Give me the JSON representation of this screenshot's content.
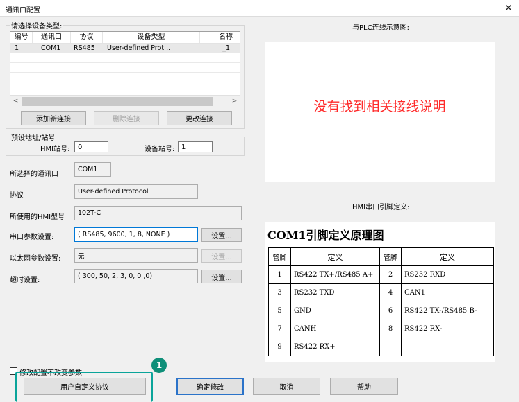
{
  "window": {
    "title": "通讯口配置",
    "close": "✕"
  },
  "device_type": {
    "group_label": "请选择设备类型:",
    "columns": [
      "编号",
      "通讯口",
      "协议",
      "设备类型",
      "名称"
    ],
    "rows": [
      [
        "1",
        "COM1",
        "RS485",
        "User-defined Prot...",
        "_1"
      ]
    ],
    "scroll_left": "<",
    "scroll_right": ">"
  },
  "connection_buttons": {
    "add": "添加新连接",
    "delete": "删除连接",
    "change": "更改连接"
  },
  "station": {
    "group_label": "预设地址/站号",
    "hmi_label": "HMI站号:",
    "hmi_value": "0",
    "device_label": "设备站号:",
    "device_value": "1"
  },
  "fields": {
    "port_label": "所选择的通讯口",
    "port_value": "COM1",
    "protocol_label": "协议",
    "protocol_value": "User-defined Protocol",
    "hmi_model_label": "所使用的HMI型号",
    "hmi_model_value": "102T-C",
    "serial_label": "串口参数设置:",
    "serial_value": "( RS485, 9600, 1, 8, NONE )",
    "serial_button": "设置...",
    "ethernet_label": "以太网参数设置:",
    "ethernet_value": "无",
    "ethernet_button": "设置...",
    "timeout_label": "超时设置:",
    "timeout_value": "( 300, 50, 2, 3, 0, 0 ,0)",
    "timeout_button": "设置..."
  },
  "wiring": {
    "label": "与PLC连线示意图:",
    "message": "没有找到相关接线说明"
  },
  "pin_def": {
    "label": "HMI串口引脚定义:",
    "title": "COM1引脚定义原理图",
    "headers": [
      "管脚",
      "定义",
      "管脚",
      "定义"
    ],
    "rows": [
      [
        "1",
        "RS422 TX+/RS485 A+",
        "2",
        "RS232 RXD"
      ],
      [
        "3",
        "RS232 TXD",
        "4",
        "CAN1"
      ],
      [
        "5",
        "GND",
        "6",
        "RS422 TX-/RS485 B-"
      ],
      [
        "7",
        "CANH",
        "8",
        "RS422 RX-"
      ],
      [
        "9",
        "RS422 RX+",
        "",
        ""
      ]
    ]
  },
  "footer": {
    "checkbox_label": "修改配置不改变参数",
    "custom_protocol": "用户自定义协议",
    "confirm": "确定修改",
    "cancel": "取消",
    "help": "帮助",
    "badge": "1"
  },
  "colors": {
    "accent": "#0078d7",
    "callout": "#0aa49a",
    "badge": "#0e8f79",
    "message": "#ff2a2a"
  }
}
